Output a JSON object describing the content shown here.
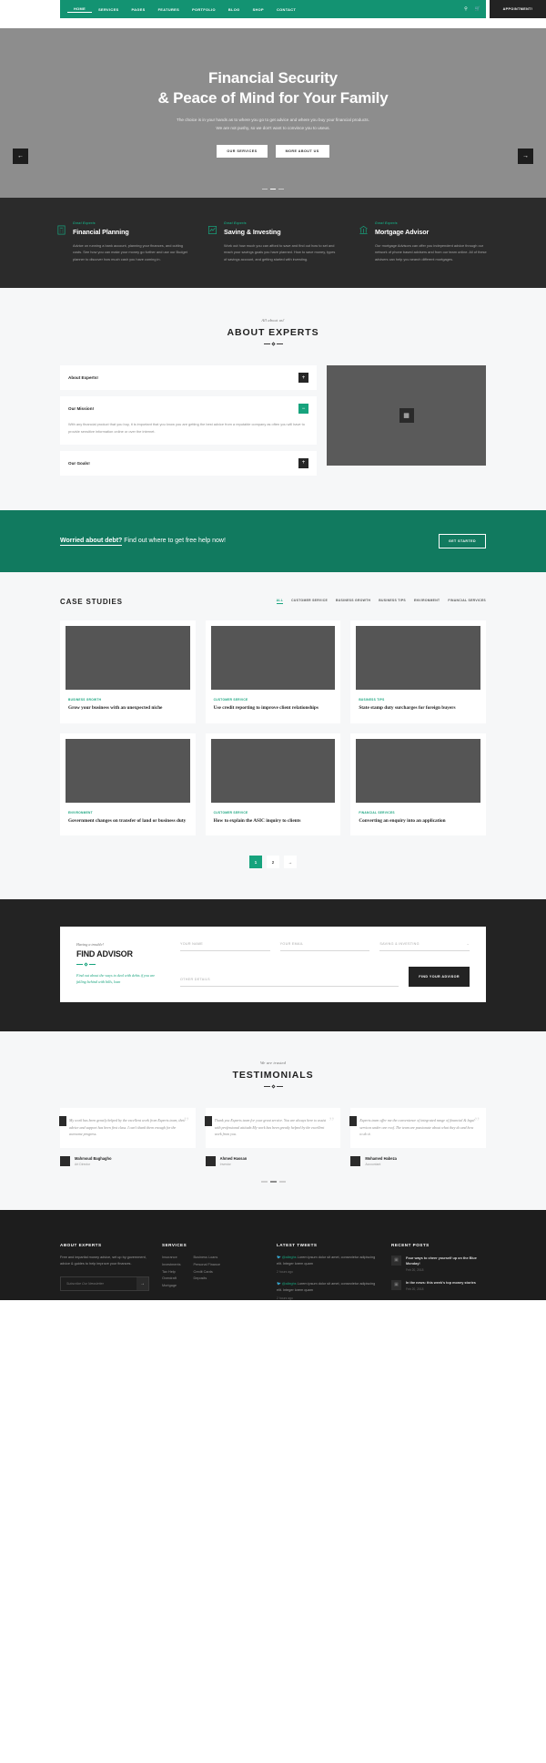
{
  "nav": {
    "items": [
      {
        "label": "HOME",
        "active": true
      },
      {
        "label": "SERVICES",
        "active": false
      },
      {
        "label": "PAGES",
        "active": false
      },
      {
        "label": "FEATURES",
        "active": false
      },
      {
        "label": "PORTFOLIO",
        "active": false
      },
      {
        "label": "BLOG",
        "active": false
      },
      {
        "label": "SHOP",
        "active": false
      },
      {
        "label": "CONTACT",
        "active": false
      }
    ],
    "search_icon": "search-icon",
    "cart_icon": "cart-icon",
    "appointment_label": "APPOINTMENT!"
  },
  "hero": {
    "title_line1": "Financial Security",
    "title_line2": "& Peace of Mind for Your Family",
    "paragraph": "The choice is in your hands as to where you go to get advice and where you buy your financial products. We are not pushy, so we don't want to convince you to useus.",
    "btn_primary": "OUR SERVICES",
    "btn_secondary": "MORE ABOUT US",
    "arrow_left": "←",
    "arrow_right": "→"
  },
  "features": [
    {
      "icon": "calculator-icon",
      "eyebrow": "Great Experts",
      "title": "Financial Planning",
      "text": "Advice on running a bank account, planning your finances, and cutting costs. See how you can make your money go further and use our Budget planner to discover how much cash you have coming in."
    },
    {
      "icon": "chart-line-icon",
      "eyebrow": "Great Experts",
      "title": "Saving & Investing",
      "text": "Work out how much you can afford to save and find out how to set and reach your savings goals you have planned. How to save money, types of savings account, and getting started with investing."
    },
    {
      "icon": "bank-icon",
      "eyebrow": "Great Experts",
      "title": "Mortgage Advisor",
      "text": "Our mortgage Advisors can offer you independent advice through our network of phone based advisers and from our team online. All of these advisers can help you search different mortgages."
    }
  ],
  "about": {
    "eyebrow": "All about us!",
    "title": "ABOUT EXPERTS",
    "accordion": [
      {
        "label": "About Experts!",
        "open": false,
        "toggle": "+",
        "body": ""
      },
      {
        "label": "Our Mission!",
        "open": true,
        "toggle": "−",
        "body": "With any financial product that you buy, it is important that you know you are getting the best advice from a reputable company as often you will have to provide sensitive information online or over the internet."
      },
      {
        "label": "Our Goals!",
        "open": false,
        "toggle": "+",
        "body": ""
      }
    ],
    "media_icon": "video-placeholder-icon"
  },
  "cta": {
    "strong": "Worried about debt?",
    "rest": " Find out where to get free help now!",
    "button": "GET STARTED"
  },
  "cases": {
    "title": "CASE STUDIES",
    "filters": [
      {
        "label": "ALL",
        "active": true
      },
      {
        "label": "CUSTOMER SERVICE",
        "active": false
      },
      {
        "label": "BUSINESS GROWTH",
        "active": false
      },
      {
        "label": "BUSINESS TIPS",
        "active": false
      },
      {
        "label": "ENVIRONMENT",
        "active": false
      },
      {
        "label": "FINANCIAL SERVICES",
        "active": false
      }
    ],
    "cards": [
      {
        "category": "BUSINESS GROWTH",
        "title": "Grow your business with an unexpected niche"
      },
      {
        "category": "CUSTOMER SERVICE",
        "title": "Use credit reporting to improve client relationships"
      },
      {
        "category": "BUSINESS TIPS",
        "title": "State stamp duty surcharges for foreign buyers"
      },
      {
        "category": "ENVIRONMENT",
        "title": "Government changes on transfer of land or business duty"
      },
      {
        "category": "CUSTOMER SERVICE",
        "title": "How to explain the ASIC inquiry to clients"
      },
      {
        "category": "FINANCIAL SERVICES",
        "title": "Converting an enquiry into an application"
      }
    ],
    "pagination": [
      {
        "label": "1",
        "active": true
      },
      {
        "label": "2",
        "active": false
      },
      {
        "label": "→",
        "active": false
      }
    ]
  },
  "advisor": {
    "eyebrow": "Having a trouble!",
    "title": "FIND ADVISOR",
    "note": "Find out about the ways to deal with debts if you are falling behind with bills, loan",
    "fields": [
      {
        "placeholder": "YOUR NAME",
        "value": "",
        "chevron": ""
      },
      {
        "placeholder": "YOUR EMAIL",
        "value": "",
        "chevron": ""
      },
      {
        "placeholder": "SAVING & INVESTING",
        "value": "",
        "chevron": "⌄"
      },
      {
        "placeholder": "OTHER DETAILS",
        "value": "",
        "chevron": ""
      }
    ],
    "submit": "FIND YOUR ADVISOR"
  },
  "testimonials": {
    "eyebrow": "We are trusted",
    "title": "TESTIMONIALS",
    "items": [
      {
        "quote": "My work has been greatly helped by the excellent work from Experts team, their advice and support has been first class. I can't thank them enough for the awesome progress.",
        "name": "Mahmoud Baghagho",
        "role": "Art Director"
      },
      {
        "quote": "Thank you Experts team for your great service. You are always here to assist with professional attitude.My work has been greatly helped by the excellent work from you.",
        "name": "Ahmed Hassan",
        "role": "Investor"
      },
      {
        "quote": "Experts team offer me the convenience of integrated range of financial & legal services under one roof. The team are passionate about what they do and how to do it.",
        "name": "Mohamed Habeza",
        "role": "Accountant"
      }
    ],
    "dots": [
      false,
      true,
      false
    ]
  },
  "footer": {
    "about": {
      "title": "ABOUT EXPERTS",
      "text": "Free and impartial money advice, set up by government, advice & guides to help improve your finances.",
      "newsletter_placeholder": "Subscribe Our Newsletter",
      "newsletter_value": "",
      "submit_icon": "arrow-right-icon"
    },
    "services": {
      "title": "SERVICES",
      "col1": [
        "Insurance",
        "Investments",
        "Tax Help",
        "Overdraft",
        "Mortgage"
      ],
      "col2": [
        "Business Loans",
        "Personal Finance",
        "Credit Cards",
        "Deposits"
      ]
    },
    "tweets": {
      "title": "LATEST TWEETS",
      "items": [
        {
          "icon": "twitter-icon",
          "handle": "@alleghs",
          "text": " Lorem ipsum dolor sit amet, consectetur adipiscing elit. Integer lorem quam",
          "time": "2 hours ago"
        },
        {
          "icon": "twitter-icon",
          "handle": "@alleghs",
          "text": " Lorem ipsum dolor sit amet, consectetur adipiscing elit. Integer lorem quam",
          "time": "2 hours ago"
        }
      ]
    },
    "posts": {
      "title": "RECENT POSTS",
      "items": [
        {
          "thumb": "image-icon",
          "title": "Four ways to cheer yourself up on the Blue Monday!",
          "date": "Feb 20, 2018"
        },
        {
          "thumb": "document-icon",
          "title": "In the news: this week's top money stories",
          "date": "Feb 20, 2018"
        }
      ]
    }
  }
}
